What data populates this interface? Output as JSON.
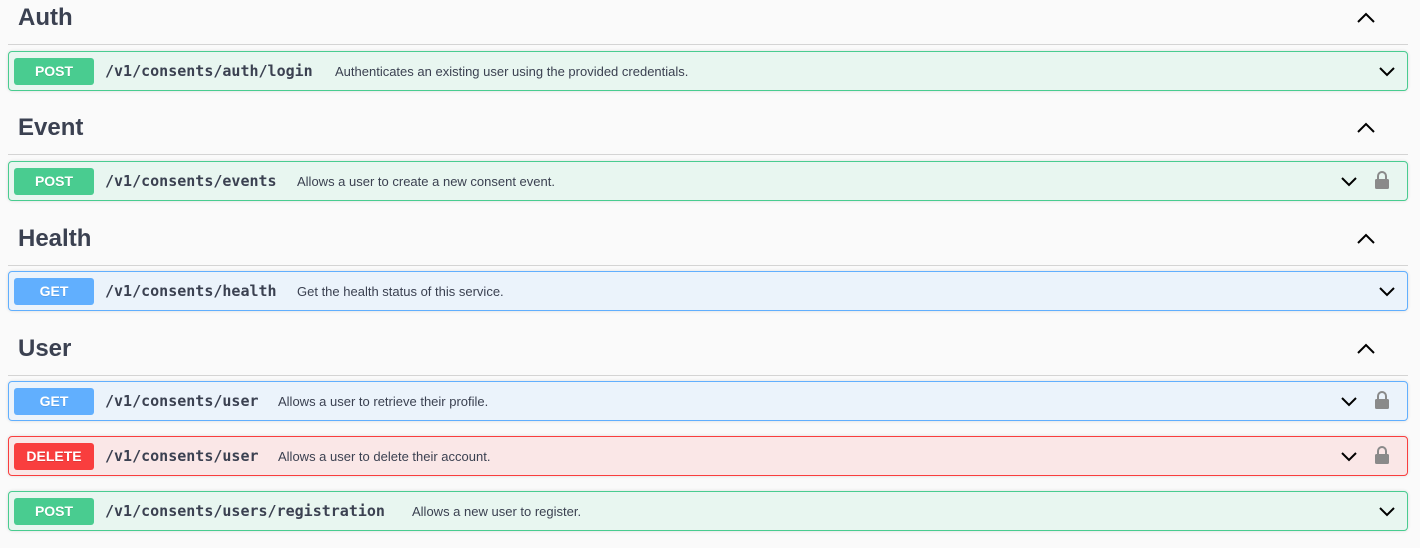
{
  "sections": [
    {
      "title": "Auth",
      "operations": [
        {
          "method": "POST",
          "path": "/v1/consents/auth/login",
          "summary": "Authenticates an existing user using the provided credentials.",
          "locked": false
        }
      ]
    },
    {
      "title": "Event",
      "operations": [
        {
          "method": "POST",
          "path": "/v1/consents/events",
          "summary": "Allows a user to create a new consent event.",
          "locked": true
        }
      ]
    },
    {
      "title": "Health",
      "operations": [
        {
          "method": "GET",
          "path": "/v1/consents/health",
          "summary": "Get the health status of this service.",
          "locked": false
        }
      ]
    },
    {
      "title": "User",
      "operations": [
        {
          "method": "GET",
          "path": "/v1/consents/user",
          "summary": "Allows a user to retrieve their profile.",
          "locked": true
        },
        {
          "method": "DELETE",
          "path": "/v1/consents/user",
          "summary": "Allows a user to delete their account.",
          "locked": true
        },
        {
          "method": "POST",
          "path": "/v1/consents/users/registration",
          "summary": "Allows a new user to register.",
          "locked": false
        }
      ]
    }
  ],
  "icons": {
    "section_toggle": "chevron-up-icon",
    "op_toggle": "chevron-down-icon",
    "lock": "lock-icon"
  },
  "colors": {
    "post": "#49cc90",
    "get": "#61affe",
    "delete": "#f93e3e",
    "text": "#3b4151"
  }
}
